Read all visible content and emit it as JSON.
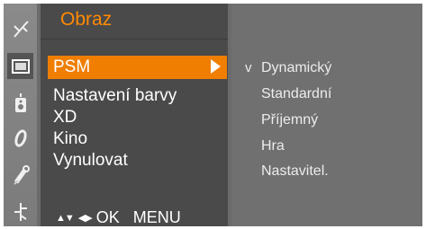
{
  "menu": {
    "title": "Obraz",
    "items": [
      {
        "label": "PSM",
        "selected": true
      },
      {
        "label": "Nastavení barvy"
      },
      {
        "label": "XD"
      },
      {
        "label": "Kino"
      },
      {
        "label": "Vynulovat"
      }
    ],
    "nav": {
      "updown_symbol": "▲▼",
      "leftright_symbol": "◀▶",
      "ok_label": "OK",
      "menu_label": "MENU"
    }
  },
  "submenu": {
    "checkmark": "v",
    "options": [
      {
        "label": "Dynamický",
        "checked": true
      },
      {
        "label": "Standardní"
      },
      {
        "label": "Příjemný"
      },
      {
        "label": "Hra"
      },
      {
        "label": "Nastavitel."
      }
    ]
  },
  "sidebar": {
    "icons": [
      "antenna-icon",
      "picture-icon",
      "audio-icon",
      "clock-icon",
      "key-icon",
      "input-icon"
    ],
    "active_index": 1
  },
  "colors": {
    "accent": "#f07e00",
    "title": "#ff8a00",
    "menu_bg": "#4a4a4a",
    "submenu_bg": "#707070",
    "sidebar_bg": "#848484"
  }
}
